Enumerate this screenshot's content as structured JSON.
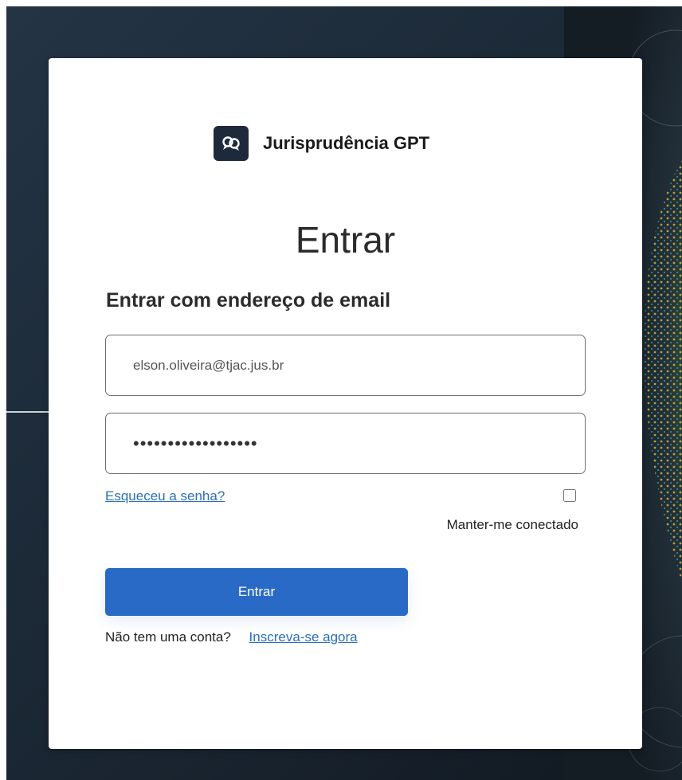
{
  "brand": {
    "name": "Jurisprudência GPT",
    "icon": "chat-bubbles-icon"
  },
  "form": {
    "title": "Entrar",
    "subtitle": "Entrar com endereço de email",
    "email_value": "elson.oliveira@tjac.jus.br",
    "password_value": "••••••••••••••••••",
    "forgot_password": "Esqueceu a senha?",
    "remember_me": "Manter-me conectado",
    "remember_checked": false,
    "submit_label": "Entrar",
    "no_account": "Não tem uma conta?",
    "signup_link": "Inscreva-se agora"
  },
  "colors": {
    "primary_button": "#2a6ac7",
    "link": "#2b6fb8",
    "logo_bg": "#1e2a3c",
    "background": "#1c2a38"
  }
}
